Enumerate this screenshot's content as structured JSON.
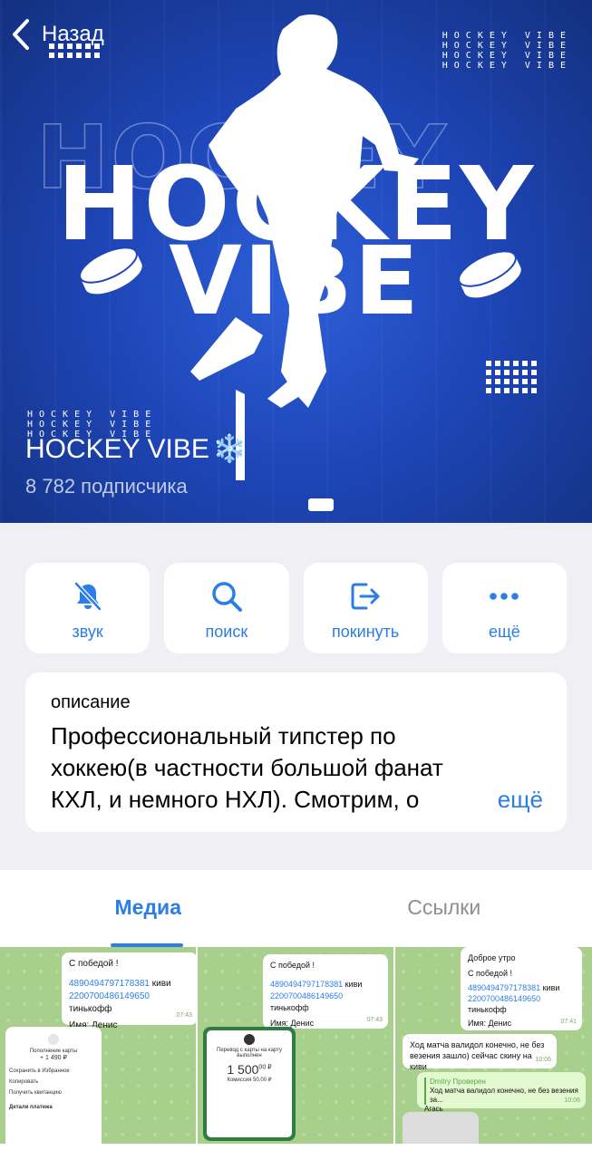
{
  "header": {
    "back_label": "Назад",
    "banner_logo_line1": "HOCKEY",
    "banner_logo_line2": "VIBE",
    "banner_tag": "HOCKEY VIBE",
    "channel_name": "HOCKEY VIBE",
    "channel_emoji": "❄️",
    "subscribers": "8 782 подписчика"
  },
  "actions": [
    {
      "label": "звук",
      "icon": "bell-muted-icon"
    },
    {
      "label": "поиск",
      "icon": "search-icon"
    },
    {
      "label": "покинуть",
      "icon": "leave-icon"
    },
    {
      "label": "ещё",
      "icon": "more-icon"
    }
  ],
  "description": {
    "title": "описание",
    "text": "Профессиональный типстер по хоккею(в частности большой фанат КХЛ, и немного НХЛ). Смотрим, о",
    "more": "ещё"
  },
  "tabs": [
    {
      "label": "Медиа",
      "active": true
    },
    {
      "label": "Ссылки",
      "active": false
    }
  ],
  "media": [
    {
      "greeting": "С победой !",
      "card1": "4890494797178381",
      "bank1": "киви",
      "card2": "2200700486149650",
      "bank2": "тинькофф",
      "name": "Имя: Денис",
      "time": "07:43",
      "receipt_title": "Пополнение карты",
      "receipt_amount": "+ 1 490 ₽",
      "receipt_item1": "Сохранить в Избранное",
      "receipt_item2": "Копировать",
      "receipt_item3": "Получить квитанцию",
      "receipt_footer": "Детали платежа"
    },
    {
      "greeting": "С победой !",
      "card1": "4890494797178381",
      "bank1": "киви",
      "card2": "2200700486149650",
      "bank2": "тинькофф",
      "name": "Имя: Денис",
      "time": "07:43",
      "transfer_title": "Перевод с карты на карту выполнен",
      "transfer_amount": "1 500",
      "transfer_kopecks": "00 ₽",
      "transfer_fee": "Комиссия 50,00 ₽"
    },
    {
      "morning": "Доброе утро",
      "greeting": "С победой !",
      "card1": "4890494797178381",
      "bank1": "киви",
      "card2": "2200700486149650",
      "bank2": "тинькофф",
      "name": "Имя: Денис",
      "time": "07:41",
      "message": "Ход матча валидол конечно, не без везения зашло) сейчас скину на киви",
      "message_time": "10:06",
      "reply_author": "Dmitry Проверен",
      "reply_quote": "Ход матча валидол конечно, не без везения за...",
      "reply_text": "Агась",
      "reply_time": "10:06"
    }
  ],
  "colors": {
    "accent": "#2a7ee6",
    "banner_blue": "#1e46b8",
    "background": "#efeff4",
    "chat_green": "#a9cf8d"
  }
}
